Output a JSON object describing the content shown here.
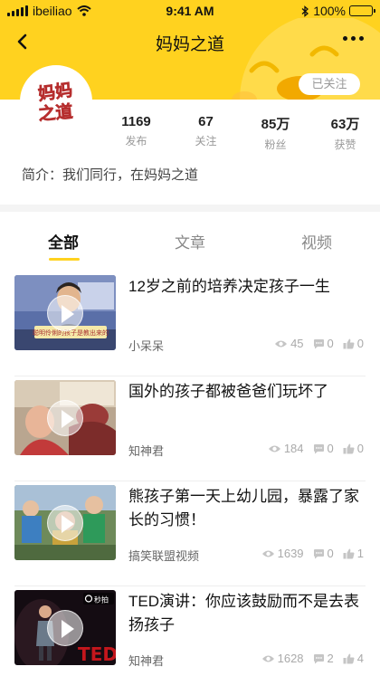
{
  "status_bar": {
    "carrier": "ibeiliao",
    "time": "9:41 AM",
    "battery": "100%",
    "battery_level": 1.0
  },
  "nav": {
    "title": "妈妈之道",
    "follow_label": "已关注"
  },
  "profile": {
    "avatar_text": "妈妈之道",
    "stats": [
      {
        "value": "1169",
        "label": "发布"
      },
      {
        "value": "67",
        "label": "关注"
      },
      {
        "value": "85万",
        "label": "粉丝"
      },
      {
        "value": "63万",
        "label": "获赞"
      }
    ],
    "intro": "简介：我们同行，在妈妈之道"
  },
  "tabs": [
    {
      "label": "全部",
      "active": true
    },
    {
      "label": "文章",
      "active": false
    },
    {
      "label": "视频",
      "active": false
    }
  ],
  "items": [
    {
      "title": "12岁之前的培养决定孩子一生",
      "author": "小呆呆",
      "views": "45",
      "comments": "0",
      "likes": "0",
      "thumb_caption": "聪明伶俐的孩子是教出来的"
    },
    {
      "title": "国外的孩子都被爸爸们玩坏了",
      "author": "知神君",
      "views": "184",
      "comments": "0",
      "likes": "0"
    },
    {
      "title": "熊孩子第一天上幼儿园，暴露了家长的习惯！",
      "author": "搞笑联盟视频",
      "views": "1639",
      "comments": "0",
      "likes": "1"
    },
    {
      "title": "TED演讲：你应该鼓励而不是去表扬孩子",
      "author": "知神君",
      "views": "1628",
      "comments": "2",
      "likes": "4",
      "thumb_badge": "秒拍",
      "thumb_watermark": "TED"
    }
  ],
  "colors": {
    "brand_yellow": "#ffd21f",
    "avatar_red": "#e94b4b"
  }
}
